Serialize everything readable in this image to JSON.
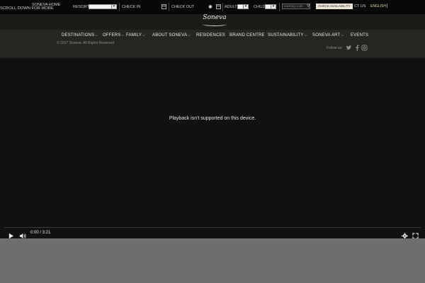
{
  "booking_bar": {
    "scroll_hint": "SCROLL DOWN FOR MORE",
    "home_link": "SONEVA HOME",
    "resort_label": "RESORT",
    "check_in_label": "CHECK IN",
    "check_out_label": "CHECK OUT",
    "adult_label": "ADULT",
    "child_label": "CHILD",
    "booking_code_placeholder": "booking code",
    "check_availability": "CHECK AVAILABILITY",
    "contact_us": "CT US",
    "language": "ENGLISH"
  },
  "brand": {
    "logo_text": "Soneva"
  },
  "nav": {
    "items": [
      {
        "label": "DESTINATIONS",
        "has_dropdown": true
      },
      {
        "label": "OFFERS",
        "has_dropdown": true
      },
      {
        "label": "FAMILY",
        "has_dropdown": true
      },
      {
        "label": "ABOUT SONEVA",
        "has_dropdown": true
      },
      {
        "label": "RESIDENCES",
        "has_dropdown": false
      },
      {
        "label": "BRAND CENTRE",
        "has_dropdown": false
      },
      {
        "label": "SUSTAINABILITY",
        "has_dropdown": true
      },
      {
        "label": "SONEVA ART",
        "has_dropdown": true
      },
      {
        "label": "EVENTS",
        "has_dropdown": false
      }
    ]
  },
  "footer": {
    "copyright": "© 2017 Soneva. All Rights Reserved.",
    "follow_us": "Follow us:",
    "social_icons": [
      "twitter-icon",
      "facebook-icon",
      "instagram-icon"
    ]
  },
  "video": {
    "message": "Playback isn't supported on this device.",
    "time": "0:00 / 3:21"
  },
  "colors": {
    "topbar": "#080808",
    "nav_band": "#262520",
    "video_bg": "#111111",
    "page_bg": "#6e6e6e"
  }
}
